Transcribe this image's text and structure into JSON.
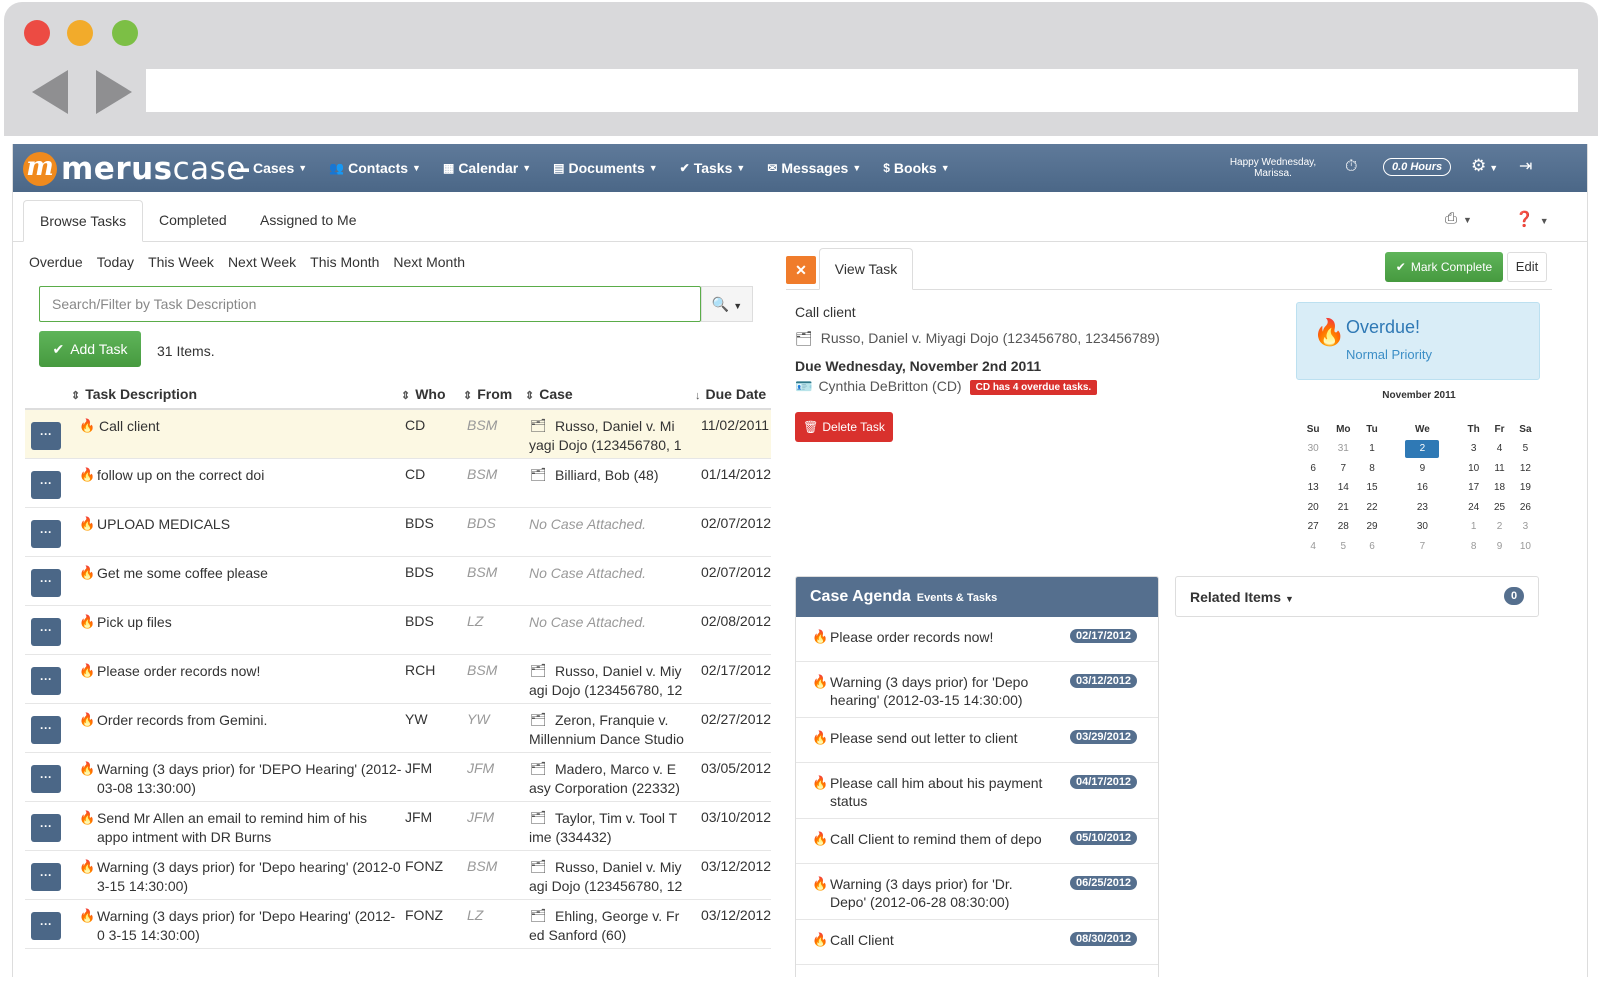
{
  "nav": {
    "logo_prefix": "m",
    "logo_bold": "merus",
    "logo_light": "case",
    "items": [
      {
        "icon": "▬",
        "label": "Cases"
      },
      {
        "icon": "👥",
        "label": "Contacts"
      },
      {
        "icon": "▦",
        "label": "Calendar"
      },
      {
        "icon": "▤",
        "label": "Documents"
      },
      {
        "icon": "✔",
        "label": "Tasks"
      },
      {
        "icon": "✉",
        "label": "Messages"
      },
      {
        "icon": "$",
        "label": "Books"
      }
    ],
    "greeting_line1": "Happy Wednesday,",
    "greeting_line2": "Marissa.",
    "hours": "0.0 Hours"
  },
  "tabs": [
    "Browse Tasks",
    "Completed",
    "Assigned to Me"
  ],
  "filters": [
    "Overdue",
    "Today",
    "This Week",
    "Next Week",
    "This Month",
    "Next Month"
  ],
  "search": {
    "placeholder": "Search/Filter by Task Description"
  },
  "add_task_label": "Add Task",
  "items_count": "31 Items.",
  "table": {
    "headers": {
      "desc": "Task Description",
      "who": "Who",
      "from": "From",
      "case": "Case",
      "due": "Due Date"
    },
    "rows": [
      {
        "desc": "Call client",
        "who": "CD",
        "from": "BSM",
        "case": "Russo, Daniel v. Mi yagi Dojo (123456780, 1",
        "due": "11/02/2011"
      },
      {
        "desc": "follow up on the correct doi",
        "who": "CD",
        "from": "BSM",
        "case": "Billiard, Bob (48)",
        "due": "01/14/2012"
      },
      {
        "desc": "UPLOAD MEDICALS",
        "who": "BDS",
        "from": "BDS",
        "case": "No Case Attached.",
        "due": "02/07/2012"
      },
      {
        "desc": "Get me some coffee please",
        "who": "BDS",
        "from": "BSM",
        "case": "No Case Attached.",
        "due": "02/07/2012"
      },
      {
        "desc": "Pick up files",
        "who": "BDS",
        "from": "LZ",
        "case": "No Case Attached.",
        "due": "02/08/2012"
      },
      {
        "desc": "Please order records now!",
        "who": "RCH",
        "from": "BSM",
        "case": "Russo, Daniel v. Miy agi Dojo (123456780, 12",
        "due": "02/17/2012"
      },
      {
        "desc": "Order records from Gemini.",
        "who": "YW",
        "from": "YW",
        "case": "Zeron, Franquie v. Millennium Dance Studio",
        "due": "02/27/2012"
      },
      {
        "desc": "Warning (3 days prior) for 'DEPO Hearing' (2012-03-08 13:30:00)",
        "who": "JFM",
        "from": "JFM",
        "case": "Madero, Marco v. E asy Corporation (22332)",
        "due": "03/05/2012"
      },
      {
        "desc": "Send Mr Allen an email to remind him of his appo intment with DR Burns",
        "who": "JFM",
        "from": "JFM",
        "case": "Taylor, Tim v. Tool T ime (334432)",
        "due": "03/10/2012"
      },
      {
        "desc": "Warning (3 days prior) for 'Depo hearing' (2012-0 3-15 14:30:00)",
        "who": "FONZ",
        "from": "BSM",
        "case": "Russo, Daniel v. Miy agi Dojo (123456780, 12",
        "due": "03/12/2012"
      },
      {
        "desc": "Warning (3 days prior) for 'Depo Hearing' (2012-0 3-15 14:30:00)",
        "who": "FONZ",
        "from": "LZ",
        "case": "Ehling, George v. Fr ed Sanford (60)",
        "due": "03/12/2012"
      }
    ]
  },
  "view_task": {
    "tab_label": "View Task",
    "mark_complete": "Mark Complete",
    "edit": "Edit",
    "title": "Call client",
    "case": "Russo, Daniel v. Miyagi Dojo (123456780, 123456789)",
    "due": "Due Wednesday, November 2nd 2011",
    "assignee": "Cynthia DeBritton (CD)",
    "overdue_badge": "CD has 4 overdue tasks.",
    "delete": "Delete Task",
    "status_title": "Overdue!",
    "priority": "Normal Priority"
  },
  "calendar": {
    "month": "November 2011",
    "days": [
      "Su",
      "Mo",
      "Tu",
      "We",
      "Th",
      "Fr",
      "Sa"
    ],
    "weeks": [
      [
        "30",
        "31",
        "1",
        "2",
        "3",
        "4",
        "5"
      ],
      [
        "6",
        "7",
        "8",
        "9",
        "10",
        "11",
        "12"
      ],
      [
        "13",
        "14",
        "15",
        "16",
        "17",
        "18",
        "19"
      ],
      [
        "20",
        "21",
        "22",
        "23",
        "24",
        "25",
        "26"
      ],
      [
        "27",
        "28",
        "29",
        "30",
        "1",
        "2",
        "3"
      ],
      [
        "4",
        "5",
        "6",
        "7",
        "8",
        "9",
        "10"
      ]
    ],
    "selected": "2"
  },
  "agenda": {
    "title": "Case Agenda",
    "subtitle": "Events & Tasks",
    "items": [
      {
        "text": "Please order records now!",
        "date": "02/17/2012"
      },
      {
        "text": "Warning (3 days prior) for 'Depo hearing' (2012-03-15 14:30:00)",
        "date": "03/12/2012"
      },
      {
        "text": "Please send out letter to client",
        "date": "03/29/2012"
      },
      {
        "text": "Please call him about his payment status",
        "date": "04/17/2012"
      },
      {
        "text": "Call Client to remind them of depo",
        "date": "05/10/2012"
      },
      {
        "text": "Warning (3 days prior) for 'Dr. Depo' (2012-06-28 08:30:00)",
        "date": "06/25/2012"
      },
      {
        "text": "Call Client",
        "date": "08/30/2012"
      }
    ]
  },
  "related": {
    "title": "Related Items",
    "count": "0"
  },
  "colors": {
    "nav": "#4b6787",
    "accent_orange": "#f08a1d",
    "green": "#469a3f",
    "red": "#d9312d",
    "blue": "#2f79b5"
  }
}
